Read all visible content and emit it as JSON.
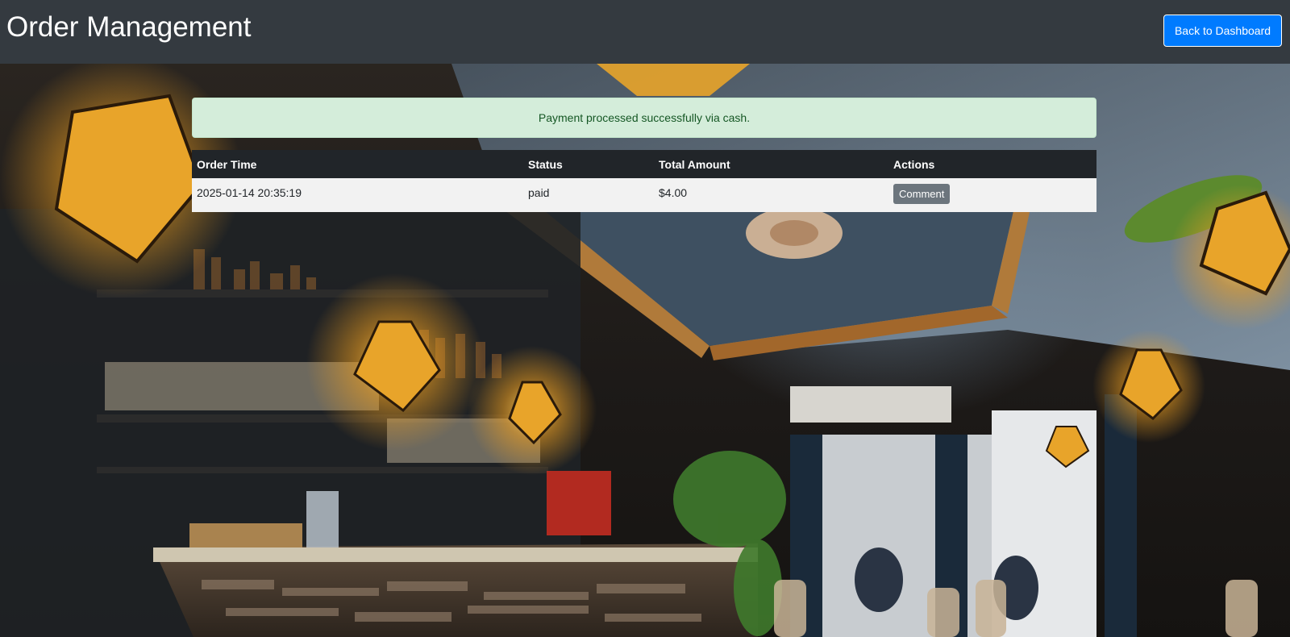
{
  "header": {
    "title": "Order Management",
    "back_button_label": "Back to Dashboard"
  },
  "alert": {
    "message": "Payment processed successfully via cash."
  },
  "orders_table": {
    "columns": [
      "Order Time",
      "Status",
      "Total Amount",
      "Actions"
    ],
    "rows": [
      {
        "order_time": "2025-01-14 20:35:19",
        "status": "paid",
        "total_amount": "$4.00",
        "action_label": "Comment"
      }
    ]
  },
  "colors": {
    "header_bg": "#343a40",
    "primary": "#007bff",
    "alert_bg": "#d4edda",
    "alert_text": "#155724",
    "table_head_bg": "#212529",
    "secondary": "#6c757d"
  },
  "background": {
    "description_icon": "restaurant-bar-background"
  }
}
